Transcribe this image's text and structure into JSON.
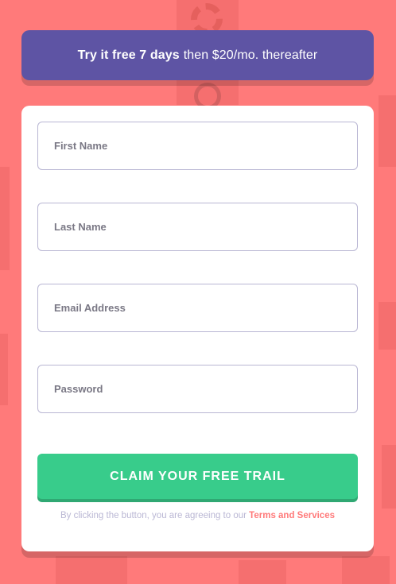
{
  "banner": {
    "bold_text": "Try it free 7 days",
    "text": "then $20/mo. thereafter"
  },
  "form": {
    "first_name_placeholder": "First Name",
    "last_name_placeholder": "Last Name",
    "email_placeholder": "Email Address",
    "password_placeholder": "Password",
    "submit_label": "CLAIM YOUR FREE TRAIL",
    "terms_prefix": "By clicking the button, you are agreeing to our",
    "terms_link": "Terms and Services"
  },
  "colors": {
    "background": "#ff7a7a",
    "banner": "#5e54a4",
    "button": "#38cc8b",
    "link": "#ff7a7a"
  }
}
